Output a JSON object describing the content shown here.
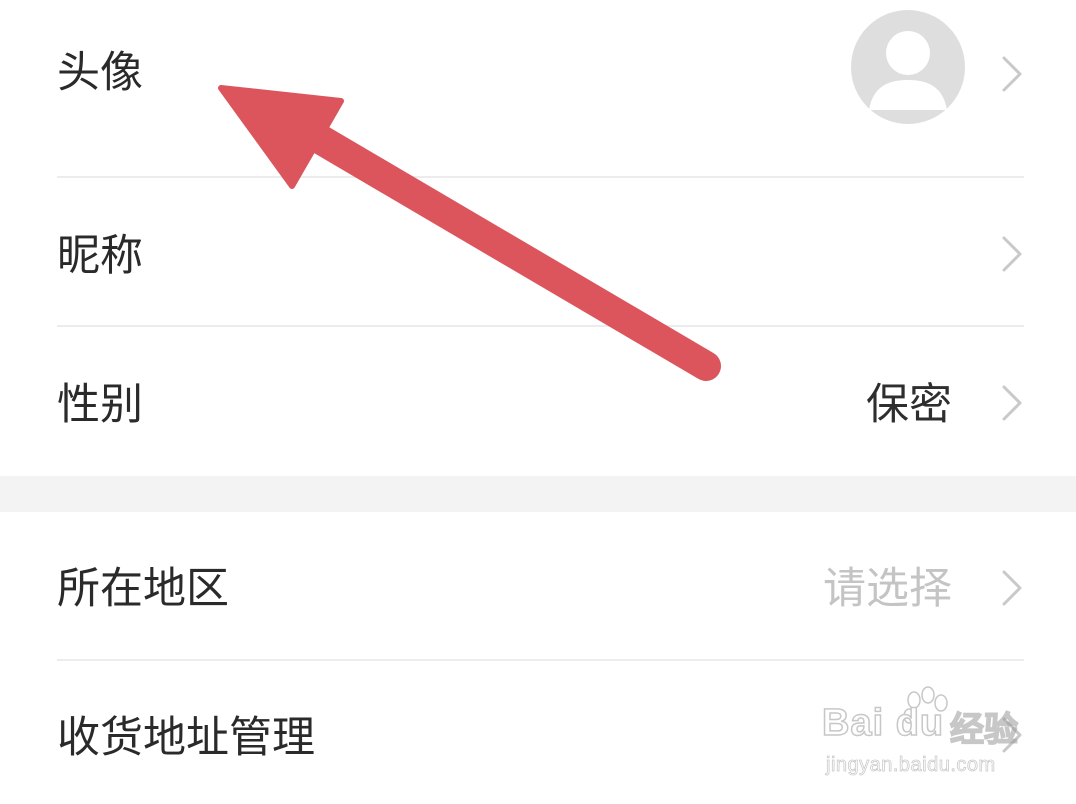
{
  "rows": {
    "avatar": {
      "label": "头像"
    },
    "nickname": {
      "label": "昵称"
    },
    "gender": {
      "label": "性别",
      "value": "保密"
    },
    "region": {
      "label": "所在地区",
      "value": "请选择"
    },
    "address": {
      "label": "收货地址管理"
    }
  },
  "icons": {
    "chevron": "chevron-right-icon",
    "avatar": "default-avatar-icon",
    "annotation": "red-arrow-annotation"
  },
  "watermark": {
    "brand": "Bai du",
    "product": "经验",
    "url": "jingyan.baidu.com"
  },
  "colors": {
    "arrow": "#dc555c",
    "avatar_bg": "#dedede",
    "section_gap": "#f3f3f3",
    "muted_text": "#c4c4c4"
  }
}
